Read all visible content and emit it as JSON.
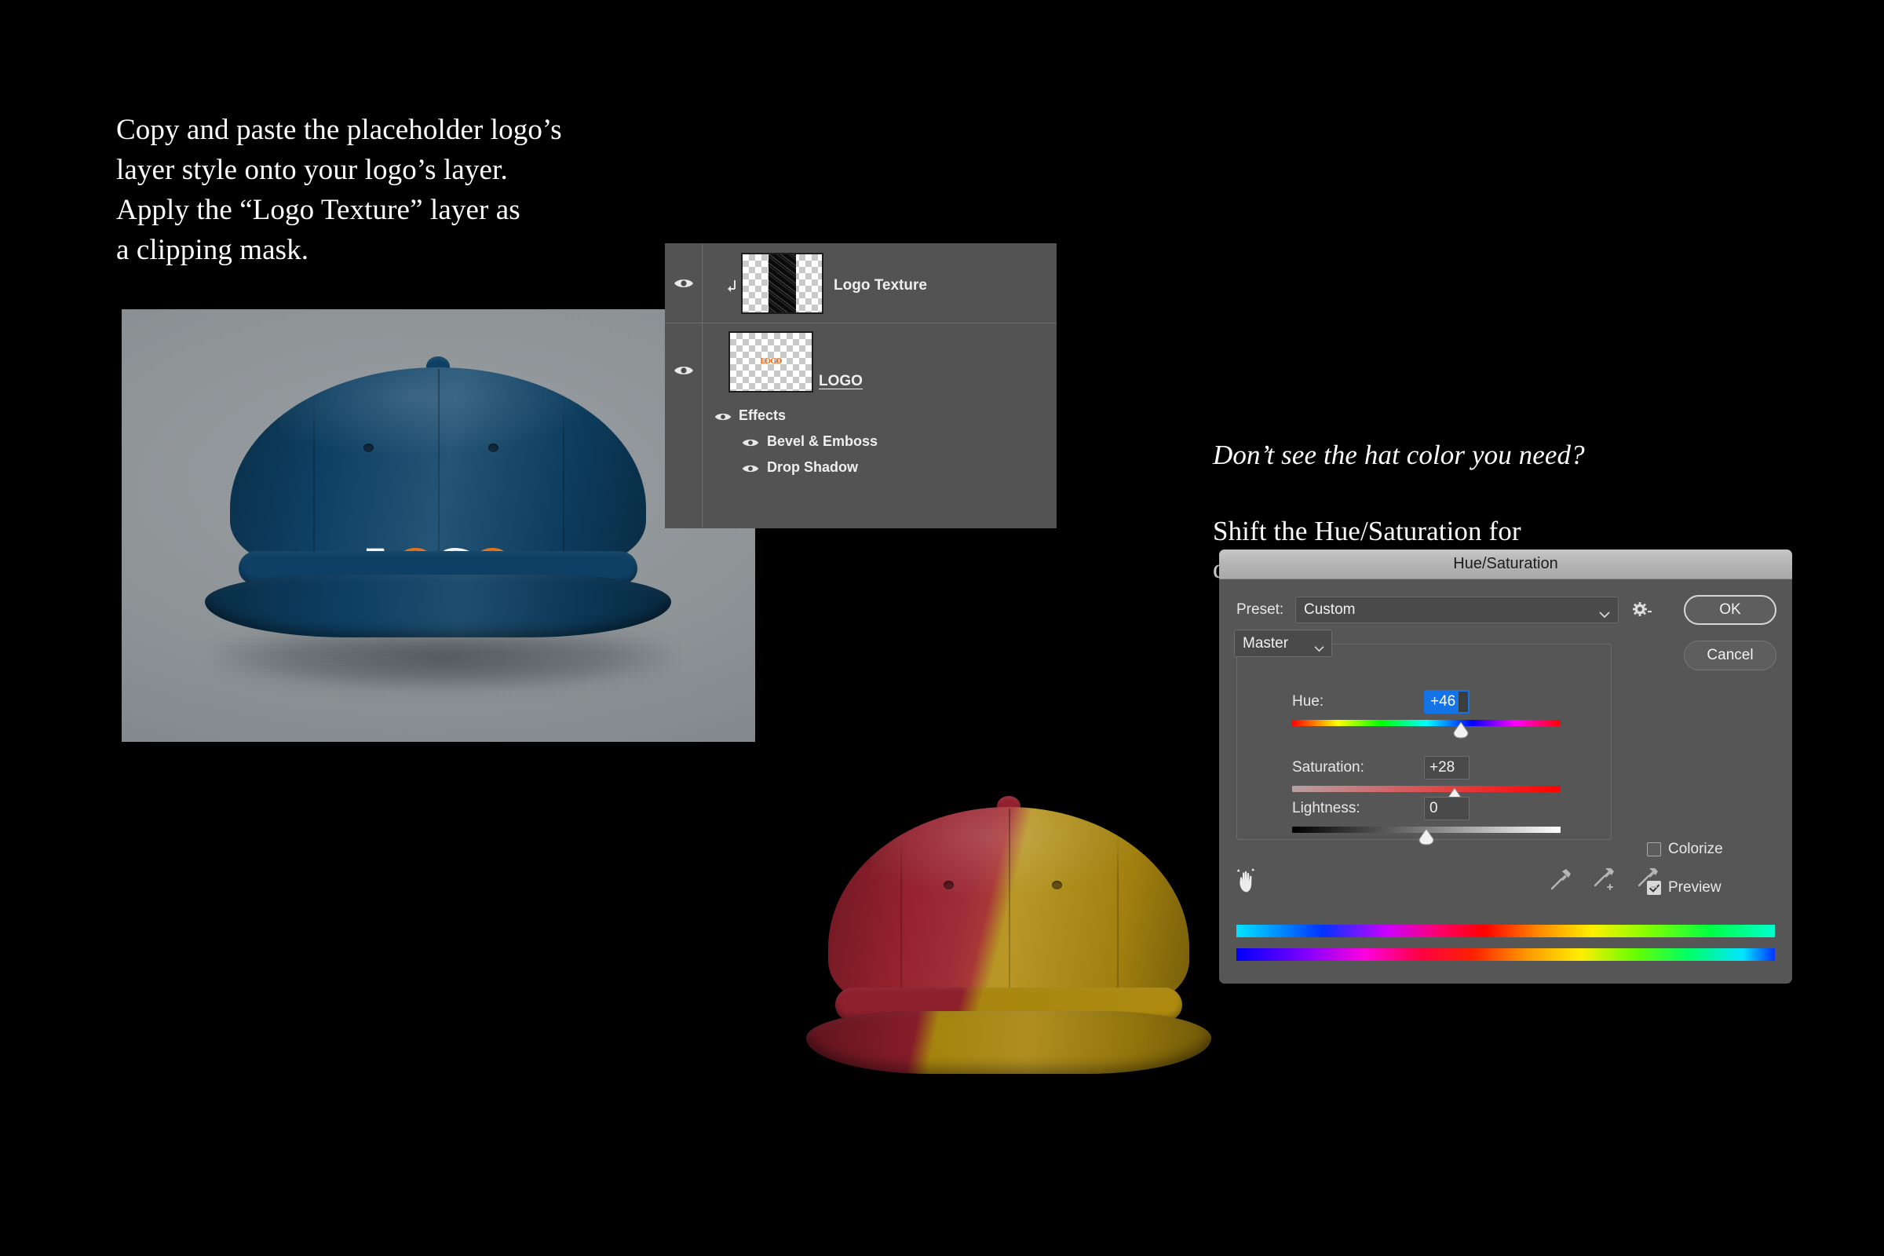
{
  "instructions": {
    "left": "Copy and paste the placeholder logo’s\nlayer style onto your logo’s layer.\nApply the “Logo Texture” layer as\na clipping mask.",
    "right_italic": "Don’t see the hat color you need?",
    "right_regular": "Shift the Hue/Saturation for\ndesired color."
  },
  "hat_photo": {
    "logo_letters": [
      "L",
      "O",
      "G",
      "O"
    ],
    "logo_text": "LOGO",
    "hat_color": "#0e4368",
    "logo_white": "#f3f4f2",
    "logo_orange": "#e8711c",
    "background_color": "#8f9598"
  },
  "two_tone_hat": {
    "left_color": "#9c2433",
    "right_color": "#b18e12"
  },
  "layers_panel": {
    "rows": [
      {
        "name": "Logo Texture",
        "clipped": true,
        "visible": true,
        "thumb": "texture-thumbnail"
      },
      {
        "name": "LOGO",
        "clipped": false,
        "visible": true,
        "thumb": "logo-thumbnail",
        "thumb_text": "LOGO"
      }
    ],
    "effects": {
      "label": "Effects",
      "items": [
        "Bevel & Emboss",
        "Drop Shadow"
      ]
    }
  },
  "hue_saturation_dialog": {
    "title": "Hue/Saturation",
    "preset_label": "Preset:",
    "preset_value": "Custom",
    "gear_icon": "gear-icon",
    "ok_label": "OK",
    "cancel_label": "Cancel",
    "channel_value": "Master",
    "sliders": [
      {
        "label": "Hue:",
        "value": "+46",
        "percent": 62.8,
        "focused": true
      },
      {
        "label": "Saturation:",
        "value": "+28",
        "percent": 60.5,
        "focused": false
      },
      {
        "label": "Lightness:",
        "value": "0",
        "percent": 50.0,
        "focused": false
      }
    ],
    "colorize_label": "Colorize",
    "colorize_checked": false,
    "preview_label": "Preview",
    "preview_checked": true,
    "hand_tool_icon": "scrubby-hand-icon",
    "eyedroppers": [
      "eyedropper-icon",
      "eyedropper-add-icon",
      "eyedropper-subtract-icon"
    ]
  }
}
